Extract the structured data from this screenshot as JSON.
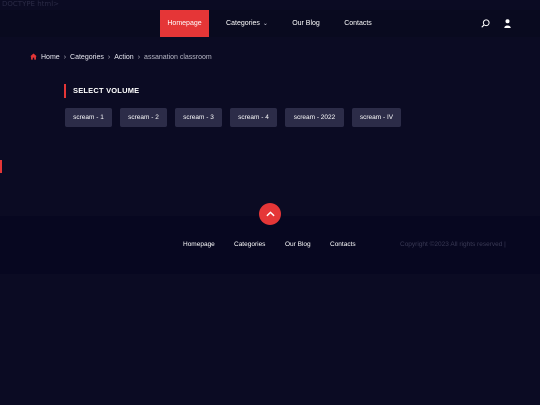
{
  "doctype_text": "DOCTYPE html>",
  "header": {
    "nav": [
      {
        "label": "Homepage",
        "active": true
      },
      {
        "label": "Categories",
        "has_dropdown": true
      },
      {
        "label": "Our Blog"
      },
      {
        "label": "Contacts"
      }
    ],
    "icons": [
      "search-icon",
      "user-icon"
    ],
    "dropdown_icon": "chevron-down-icon"
  },
  "breadcrumb": {
    "items": [
      "Home",
      "Categories",
      "Action"
    ],
    "current": "assanation classroom",
    "home_icon": "home-icon",
    "separator_icon": "chevron-right-icon"
  },
  "section": {
    "title": "SELECT VOLUME",
    "volumes": [
      "scream - 1",
      "scream - 2",
      "scream - 3",
      "scream - 4",
      "scream - 2022",
      "scream - IV"
    ]
  },
  "footer": {
    "back_to_top_icon": "chevron-up-icon",
    "links": [
      "Homepage",
      "Categories",
      "Our Blog",
      "Contacts"
    ],
    "copyright": "Copyright ©2023 All rights reserved |"
  },
  "colors": {
    "background": "#0b0b23",
    "header": "#090a1f",
    "accent": "#e53637",
    "button": "#2c2c48",
    "footer": "#070720"
  }
}
